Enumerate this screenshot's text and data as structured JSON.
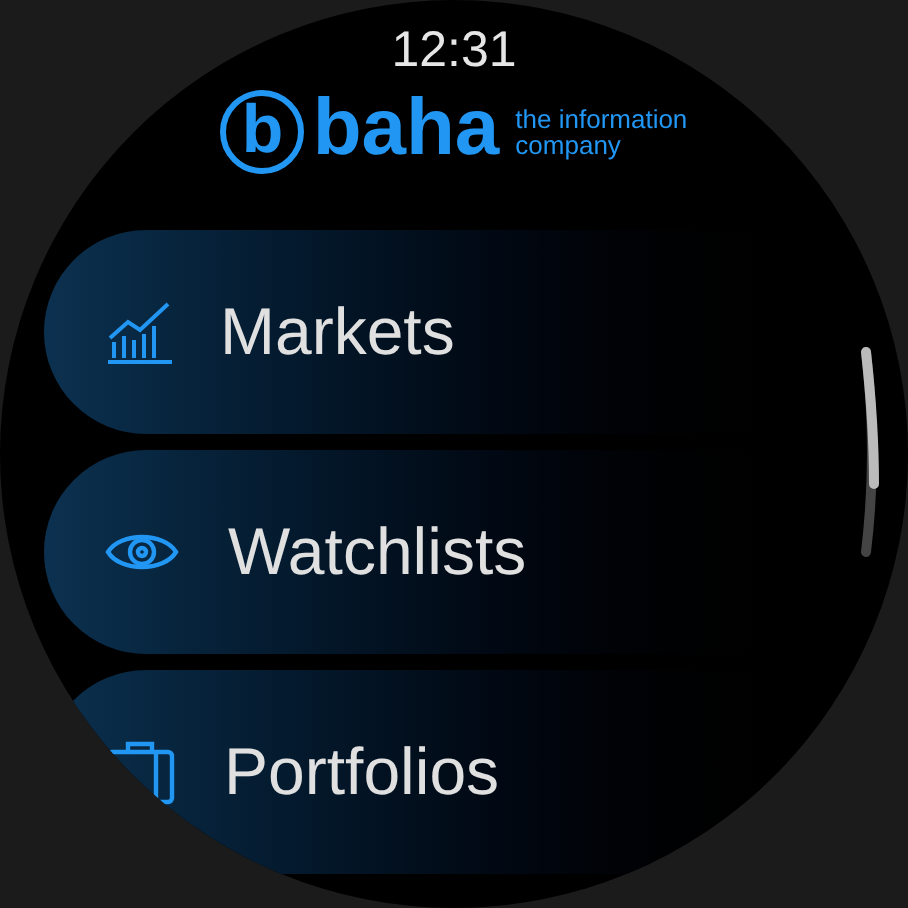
{
  "time": "12:31",
  "logo": {
    "mark": "b",
    "name": "baha",
    "tagline": [
      "the information",
      "company"
    ]
  },
  "menu": [
    {
      "label": "Markets",
      "kind": "chart"
    },
    {
      "label": "Watchlists",
      "kind": "eye"
    },
    {
      "label": "Portfolios",
      "kind": "briefcase"
    }
  ]
}
